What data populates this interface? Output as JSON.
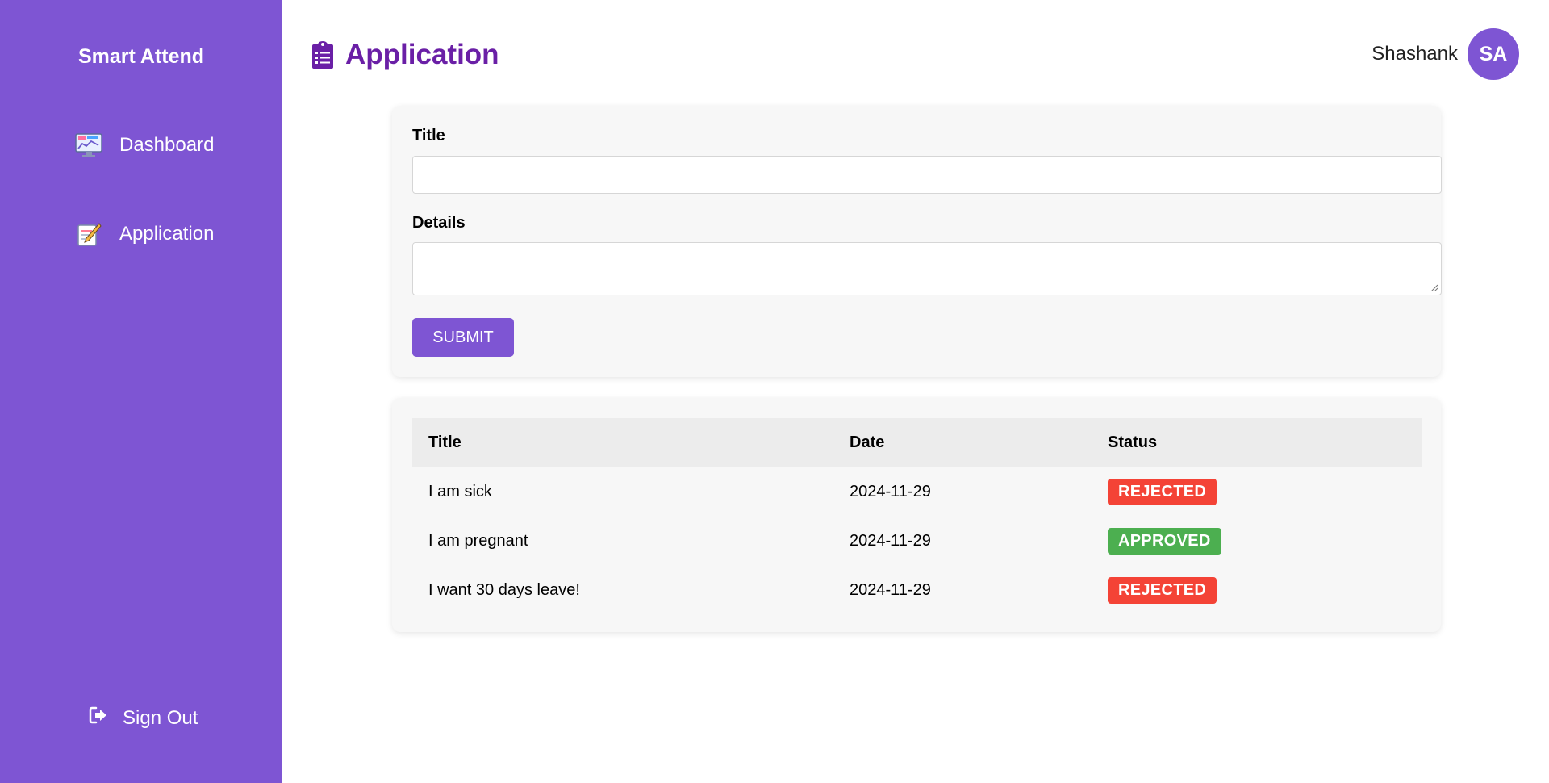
{
  "sidebar": {
    "brand": "Smart Attend",
    "items": [
      {
        "label": "Dashboard",
        "icon": "dashboard-monitor-icon"
      },
      {
        "label": "Application",
        "icon": "note-pencil-icon"
      }
    ],
    "signout_label": "Sign Out",
    "signout_icon": "sign-out-icon",
    "background": "#7e55d3"
  },
  "header": {
    "title": "Application",
    "title_icon": "clipboard-list-icon",
    "title_color": "#6a1fa6",
    "user_name": "Shashank",
    "avatar_initials": "SA"
  },
  "form": {
    "title_label": "Title",
    "title_value": "",
    "details_label": "Details",
    "details_value": "",
    "submit_label": "SUBMIT"
  },
  "table": {
    "headers": [
      "Title",
      "Date",
      "Status"
    ],
    "rows": [
      {
        "title": "I am sick",
        "date": "2024-11-29",
        "status": "REJECTED"
      },
      {
        "title": "I am pregnant",
        "date": "2024-11-29",
        "status": "APPROVED"
      },
      {
        "title": "I want 30 days leave!",
        "date": "2024-11-29",
        "status": "REJECTED"
      }
    ]
  },
  "status_colors": {
    "REJECTED": "#f44336",
    "APPROVED": "#4caf50"
  }
}
